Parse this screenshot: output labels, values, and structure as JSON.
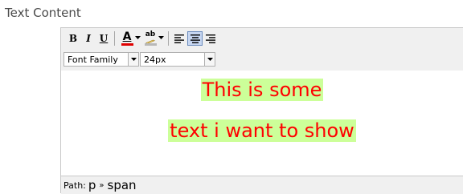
{
  "field": {
    "label": "Text Content"
  },
  "toolbar": {
    "bold": "B",
    "italic": "I",
    "underline": "U",
    "forecolor_glyph": "A",
    "forecolor": "#e00000",
    "backcolor_glyph": "ab",
    "backcolor": "#b8b8b8",
    "icons": {
      "align_left": "align-left-icon",
      "align_center": "align-center-icon",
      "align_right": "align-right-icon"
    },
    "align_center_active": true
  },
  "font_family": {
    "value": "Font Family"
  },
  "font_size": {
    "value": "24px"
  },
  "content": {
    "line1": "This is some",
    "line2": "text i want to show",
    "text_color": "#ff0000",
    "highlight_color": "#ccff99"
  },
  "status": {
    "path_label": "Path:",
    "separator": "»",
    "crumb_1": "p",
    "crumb_2": "span"
  }
}
